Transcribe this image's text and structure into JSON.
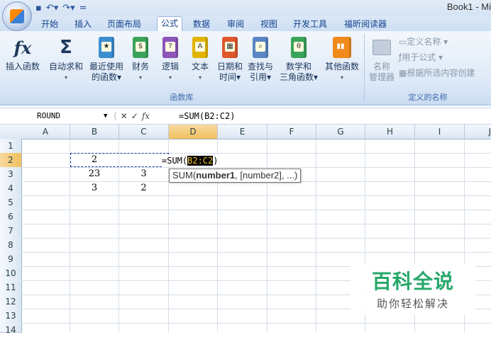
{
  "window": {
    "title": "Book1 - Mi"
  },
  "qat": {
    "save_icon": "save-icon",
    "undo_icon": "undo-icon",
    "redo_icon": "redo-icon",
    "customize": "="
  },
  "tabs": [
    "开始",
    "插入",
    "页面布局",
    "公式",
    "数据",
    "审阅",
    "视图",
    "开发工具",
    "福昕阅读器"
  ],
  "ribbon": {
    "function_library": {
      "label": "函数库",
      "buttons": [
        {
          "line1": "插入函数",
          "line2": ""
        },
        {
          "line1": "自动求和",
          "line2": "▾"
        },
        {
          "line1": "最近使用",
          "line2": "的函数▾"
        },
        {
          "line1": "财务",
          "line2": "▾"
        },
        {
          "line1": "逻辑",
          "line2": "▾"
        },
        {
          "line1": "文本",
          "line2": "▾"
        },
        {
          "line1": "日期和",
          "line2": "时间▾"
        },
        {
          "line1": "查找与",
          "line2": "引用▾"
        },
        {
          "line1": "数学和",
          "line2": "三角函数▾"
        },
        {
          "line1": "其他函数",
          "line2": "▾"
        }
      ]
    },
    "defined_names": {
      "label": "定义的名称",
      "name_manager_line1": "名称",
      "name_manager_line2": "管理器",
      "define_name": "定义名称 ▾",
      "use_in_formula": "用于公式 ▾",
      "create_from_selection": "根据所选内容创建"
    }
  },
  "formula_bar": {
    "name_box": "ROUND",
    "formula": "=SUM(B2:C2)"
  },
  "sheet": {
    "columns": [
      "A",
      "B",
      "C",
      "D",
      "E",
      "F",
      "G",
      "H",
      "I",
      "J"
    ],
    "rows": [
      "1",
      "2",
      "3",
      "4",
      "5",
      "6",
      "7",
      "8",
      "9",
      "10",
      "11",
      "12",
      "13",
      "14"
    ],
    "cells": {
      "B2": "2",
      "B3": "23",
      "C3": "3",
      "B4": "3",
      "C4": "2"
    },
    "edit_text_prefix": "=SUM(",
    "edit_text_ref": "B2:C2",
    "edit_text_suffix": ")",
    "tooltip_fn": "SUM(",
    "tooltip_arg1": "number1",
    "tooltip_rest": ", [number2], ...)"
  },
  "watermark": {
    "title": "百科全说",
    "subtitle": "助你轻松解决"
  },
  "colors": {
    "accent": "#2b579a",
    "selected_header": "#f1c15f",
    "watermark_green": "#26a86a"
  }
}
